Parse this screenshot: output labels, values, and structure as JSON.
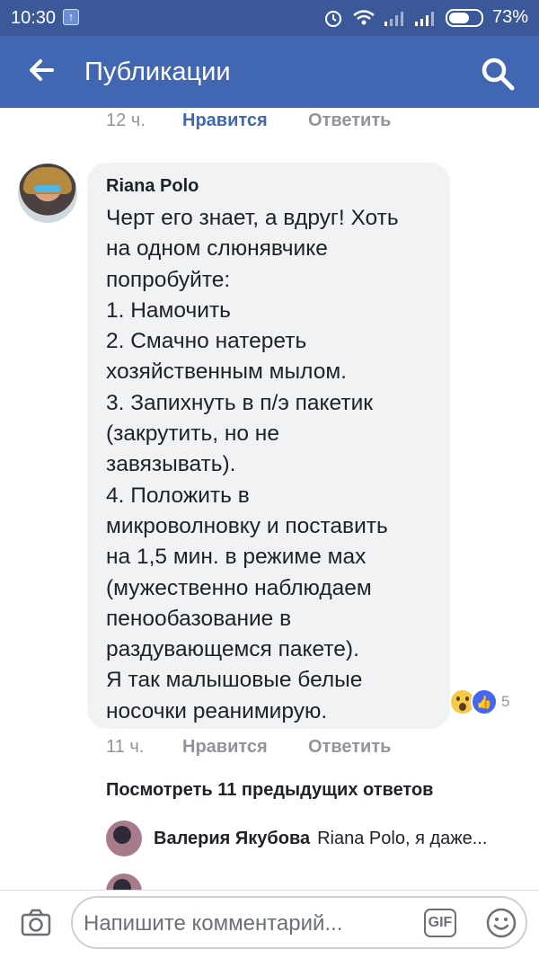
{
  "status_bar": {
    "time": "10:30",
    "battery": "73%",
    "battery_level": 0.73
  },
  "app_bar": {
    "title": "Публикации",
    "back_icon": "arrow-left-icon",
    "search_icon": "search-icon"
  },
  "prev_comment_meta": {
    "time": "12 ч.",
    "like_label": "Нравится",
    "reply_label": "Ответить"
  },
  "comment": {
    "author": "Riana Polo",
    "lines": [
      "Черт его знает, а вдруг! Хоть",
      "на одном слюнявчике",
      "попробуйте:",
      "1. Намочить",
      "2. Смачно натереть",
      "хозяйственным мылом.",
      "3. Запихнуть в п/э пакетик",
      "(закрутить, но не",
      "завязывать).",
      "4. Положить в",
      "микроволновку и поставить",
      "на 1,5 мин. в режиме мах",
      "(мужественно наблюдаем",
      "пенообазование в",
      "раздувающемся пакете).",
      "Я так малышовые белые",
      "носочки реанимирую."
    ],
    "reaction_count": "5",
    "time": "11 ч.",
    "like_label": "Нравится",
    "reply_label": "Ответить"
  },
  "replies": {
    "more_label": "Посмотреть 11 предыдущих ответов",
    "items": [
      {
        "name": "Валерия Якубова",
        "text": "Riana Polo, я даже..."
      }
    ]
  },
  "composer": {
    "placeholder": "Напишите комментарий...",
    "gif_label": "GIF"
  },
  "colors": {
    "status_bar": "#3b5998",
    "app_bar": "#4267b2",
    "accent": "#4267b2",
    "bubble": "#f1f2f4"
  }
}
